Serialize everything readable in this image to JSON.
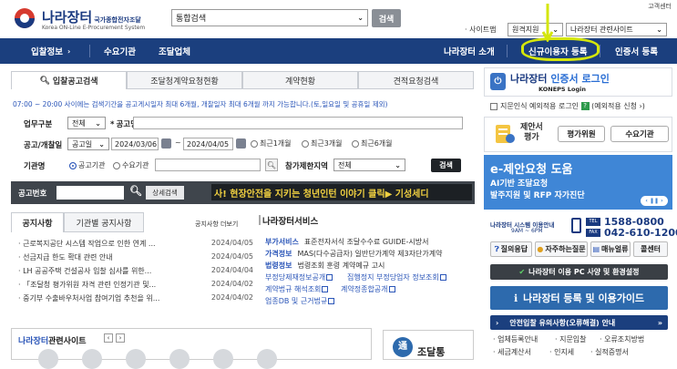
{
  "header": {
    "logo_title": "나라장터",
    "logo_tag": "국가종합전자조달",
    "logo_sub": "Korea ON-Line E-Procurement System",
    "search_select": "통합검색",
    "search_button": "검색",
    "customer_center": "고객센터",
    "sitemap_label": "· 사이트맵",
    "sitemap_select1": "원격지원",
    "sitemap_select2": "나라장터 관련사이트"
  },
  "nav": {
    "items": [
      "입찰정보",
      "수요기관",
      "조달업체"
    ],
    "right_items": [
      "나라장터 소개",
      "신규이용자 등록",
      "인증서 등록"
    ]
  },
  "tabs": [
    "입찰공고검색",
    "조달청계약요청현황",
    "계약현황",
    "견적요청검색"
  ],
  "form": {
    "notice": "07:00 ~ 20:00 사이에는 검색기간을 공고게시일자 최대 6개월, 개찰일자 최대 6개월 까지 가능합니다.(토,일요일 및 공휴일 제외)",
    "type_label": "업무구분",
    "type_value": "전체",
    "name_label": "공고명",
    "period_label": "공고/개찰일",
    "period_type": "공고일",
    "date_from": "2024/03/06",
    "date_to": "2024/04/05",
    "range_sep": "~",
    "radio_options": [
      "최근1개월",
      "최근3개월",
      "최근6개월"
    ],
    "agency_label": "기관명",
    "agency_radio": [
      "공고기관",
      "수요기관"
    ],
    "region_label": "참가제한지역",
    "region_value": "전체",
    "search_button": "검색",
    "notice_no_label": "공고번호",
    "detail_search": "상세검색",
    "ticker": "사! 현장안전을 지키는 청년인턴 이야기     클릭▶ 기성세디"
  },
  "notices": {
    "tab1": "공지사항",
    "tab2": "기관별 공지사항",
    "more": "공지사항 더보기",
    "rows": [
      {
        "title": "· 근로복지공단 시스템 작업으로 인한 연계 ...",
        "date": "2024/04/05"
      },
      {
        "title": "· 선금지급 한도 확대 관련 안내",
        "date": "2024/04/05"
      },
      {
        "title": "· LH 공공주택 건설공사 입찰 심사를 위한...",
        "date": "2024/04/04"
      },
      {
        "title": "· 「조달청 평가위원 자격 관련 인정기관 및...",
        "date": "2024/04/02"
      },
      {
        "title": "· 중기부 수출바우처사업 참여기업 추천을 위...",
        "date": "2024/04/02"
      }
    ]
  },
  "services": {
    "title": "나라장터서비스",
    "rows": [
      {
        "label": "부가서비스",
        "text": "표준전자서식 조달수수료 GUIDE-시방서"
      },
      {
        "label": "가격정보",
        "text": "MAS(다수공급자) 일반단가계약 제3자단가계약"
      },
      {
        "label": "법령정보",
        "text": "법령조회  훈령  계약예규  고시"
      }
    ],
    "link1": "부정당제재정보공개",
    "link2": "집행정지 부정당업자 정보조회",
    "link3": "계약법규 해석조회",
    "link4": "계약정종합공개",
    "link5": "업종DB 및 근거법규"
  },
  "related": {
    "prefix": "나라장터",
    "title": "관련사이트",
    "banner": "조달통"
  },
  "right": {
    "login_title_a": "나라장터",
    "login_title_b": " 인증서 로그인",
    "login_sub": "KONEPS Login",
    "cert_check": "지문인식 예외적용 로그인",
    "cert_badge": "?",
    "cert_apply": "(예외적용 신청 ›)",
    "propose_label": "제안서\n평가",
    "eval_btn": "평가위원",
    "agency_btn": "수요기관",
    "banner_title": "e-제안요청 도움",
    "banner_line1": "AI기반 조달요청",
    "banner_line2": "발주지원 및 RFP 자가진단",
    "banner_pager": "‹ ❚❚ ›",
    "hotline_label": "나라장터 시스템 이용안내",
    "hotline_time": "9AM ~ 6PM",
    "phone1": "1588-0800",
    "phone2": "042-610-1200",
    "tel_tag": "TEL",
    "fax_tag": "FAX",
    "quick": [
      "질의응답",
      "자주하는질문",
      "매뉴얼류",
      "콜센터"
    ],
    "env_btn": "나라장터 이용 PC 사양 및 환경설정",
    "reg_btn": "나라장터 등록 및 이용가이드",
    "safe_btn": "안전입찰 유의사항(오류해결) 안내",
    "bottom_links": [
      "· 업체등록안내",
      "· 지문입찰",
      "· 오류조치방법",
      "· 세금계산서",
      "· 인지세",
      "· 실적증명서"
    ]
  }
}
